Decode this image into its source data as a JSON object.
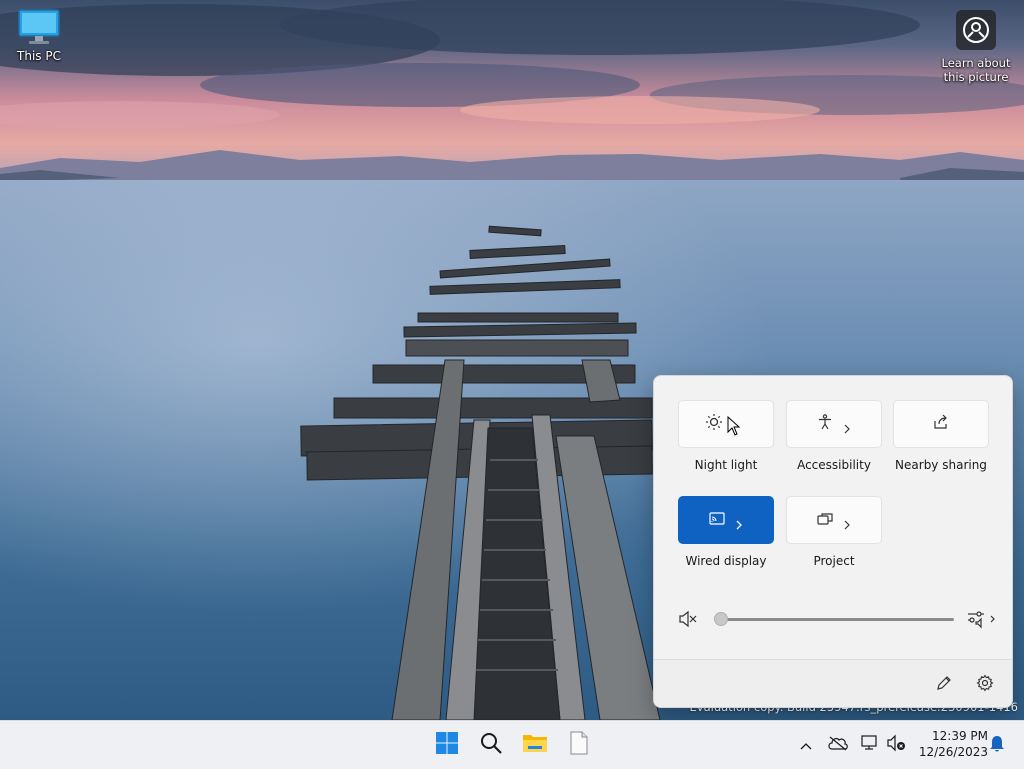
{
  "desktop": {
    "icons": [
      {
        "label": "This PC",
        "icon": "computer-monitor-icon"
      }
    ],
    "learn_about": {
      "label_line1": "Learn about",
      "label_line2": "this picture",
      "icon": "camera-info-icon"
    },
    "watermark": "Evaluation copy. Build 25947.rs_prerelease.230901-1416"
  },
  "quick_settings": {
    "tiles": [
      {
        "label": "Night light",
        "icon": "brightness-sun-icon",
        "active": false,
        "has_chevron": false
      },
      {
        "label": "Accessibility",
        "icon": "accessibility-person-icon",
        "active": false,
        "has_chevron": true
      },
      {
        "label": "Nearby sharing",
        "icon": "share-icon",
        "active": false,
        "has_chevron": false
      },
      {
        "label": "Wired display",
        "icon": "cast-display-icon",
        "active": true,
        "has_chevron": true
      },
      {
        "label": "Project",
        "icon": "project-screens-icon",
        "active": false,
        "has_chevron": true
      }
    ],
    "volume": {
      "muted": true,
      "level": 0,
      "icon": "speaker-muted-icon",
      "mixer_icon": "audio-mixer-icon"
    },
    "footer": {
      "edit_icon": "pencil-icon",
      "settings_icon": "gear-icon"
    }
  },
  "taskbar": {
    "pinned": [
      {
        "name": "Start",
        "icon": "windows-logo-icon"
      },
      {
        "name": "Search",
        "icon": "search-icon"
      },
      {
        "name": "File Explorer",
        "icon": "folder-icon"
      },
      {
        "name": "Notepad",
        "icon": "document-icon"
      }
    ],
    "tray": {
      "icons": [
        "chevron-up-icon",
        "onedrive-offline-icon",
        "network-display-icon",
        "volume-muted-icon"
      ],
      "time": "12:39 PM",
      "date": "12/26/2023",
      "notification_icon": "bell-icon"
    }
  },
  "colors": {
    "accent": "#0f62c2",
    "taskbar_bg": "#eef0f3",
    "flyout_bg": "#f2f2f2"
  }
}
